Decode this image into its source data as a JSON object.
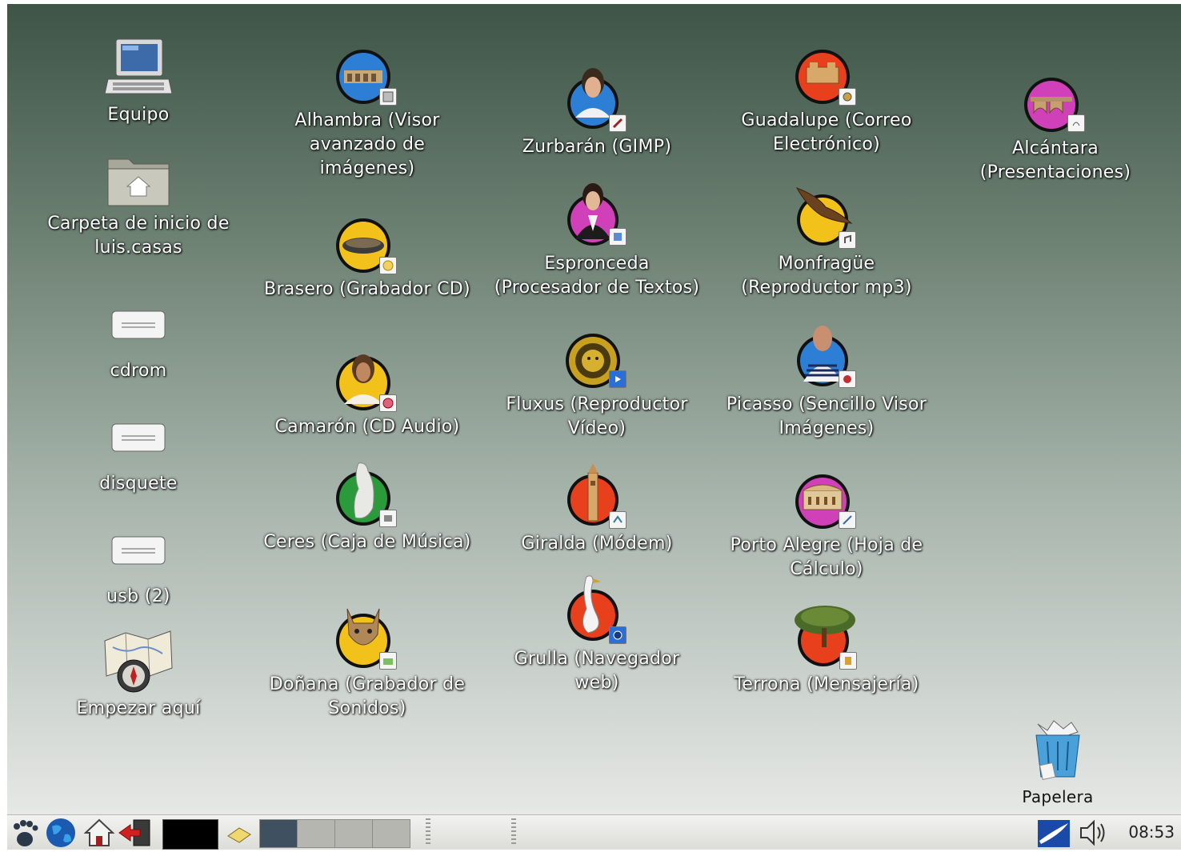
{
  "desktop": {
    "icons": {
      "equipo": "Equipo",
      "home": "Carpeta de inicio de luis.casas",
      "cdrom": "cdrom",
      "disquete": "disquete",
      "usb": "usb (2)",
      "empezar": "Empezar aquí",
      "alhambra": "Alhambra (Visor avanzado de imágenes)",
      "brasero": "Brasero (Grabador CD)",
      "camaron": "Camarón (CD Audio)",
      "ceres": "Ceres (Caja de Música)",
      "donana": "Doñana (Grabador de Sonidos)",
      "zurbaran": "Zurbarán (GIMP)",
      "espronceda": "Espronceda (Procesador de Textos)",
      "fluxus": "Fluxus (Reproductor Vídeo)",
      "giralda": "Giralda (Módem)",
      "grulla": "Grulla (Navegador web)",
      "guadalupe": "Guadalupe (Correo Electrónico)",
      "monfrague": "Monfragüe (Reproductor mp3)",
      "picasso": "Picasso (Sencillo Visor Imágenes)",
      "portoalegre": "Porto Alegre (Hoja de Cálculo)",
      "terrona": "Terrona (Mensajería)",
      "alcantara": "Alcántara (Presentaciones)",
      "papelera": "Papelera"
    }
  },
  "taskbar": {
    "clock": "08:53",
    "launchers": [
      "gnome-foot-icon",
      "globe-icon",
      "home-icon",
      "logout-icon"
    ],
    "workspaces": 4,
    "active_workspace": 1
  },
  "colors": {
    "desktop_top": "#3d5446",
    "desktop_bottom": "#e6e8e6",
    "ball_red": "#e8401c",
    "ball_yellow": "#f2c21a",
    "ball_blue": "#2c7fd4",
    "ball_pink": "#d040b8",
    "ball_green": "#2a9a3a"
  }
}
